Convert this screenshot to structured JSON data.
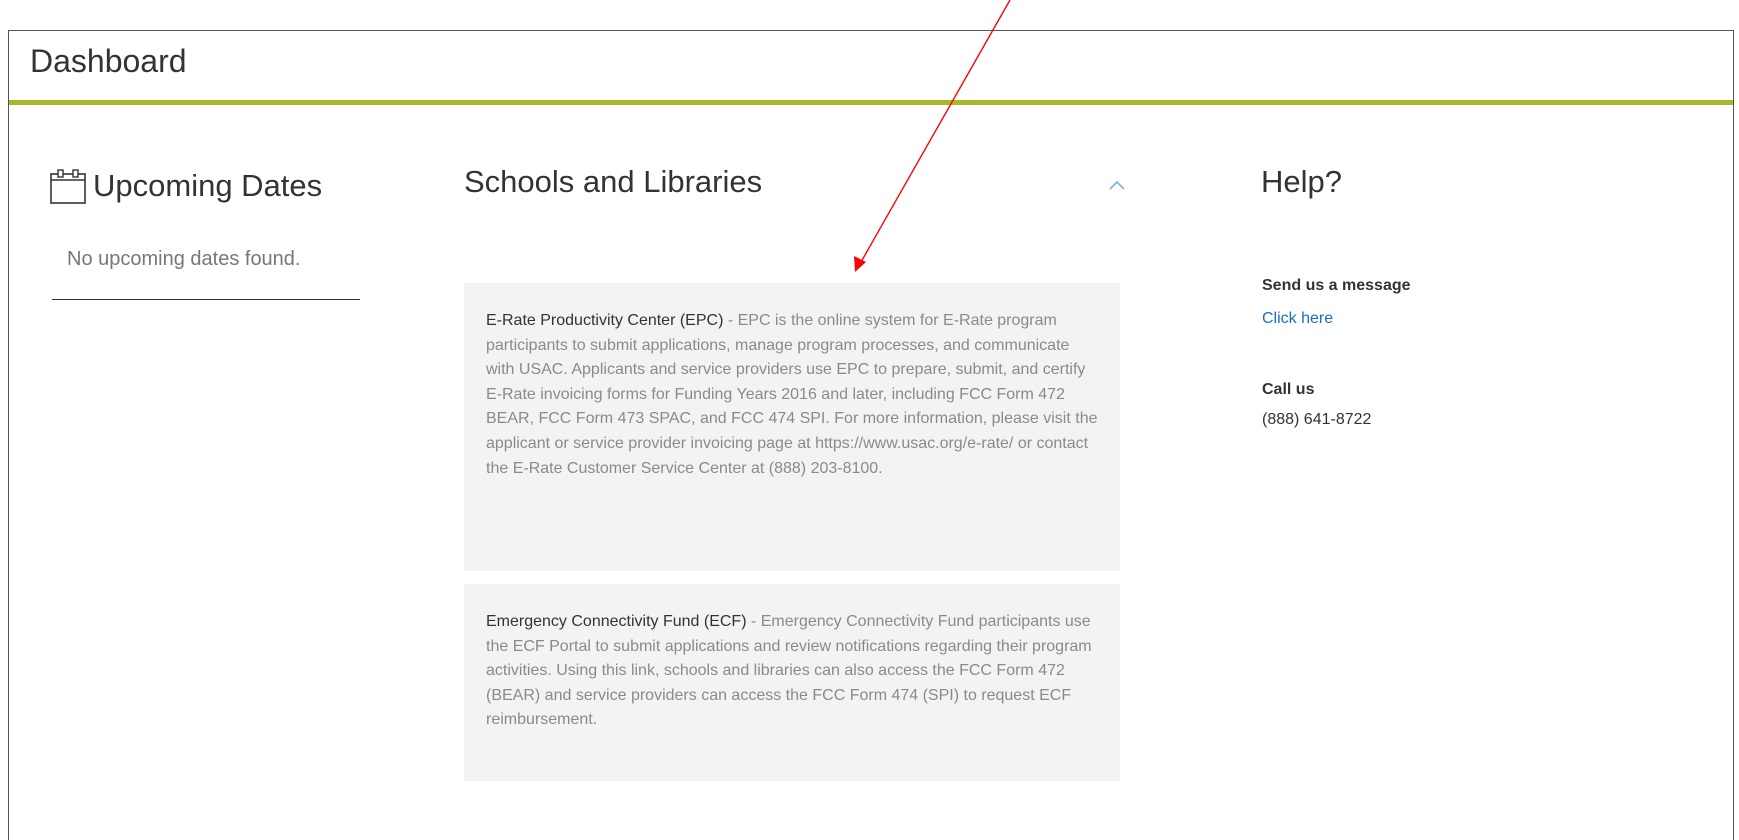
{
  "header": {
    "title": "Dashboard",
    "accent_color": "#a9b729"
  },
  "upcoming": {
    "title": "Upcoming Dates",
    "icon": "calendar-icon",
    "empty_text": "No upcoming dates found."
  },
  "schools": {
    "title": "Schools and Libraries",
    "collapse_icon": "chevron-up-icon",
    "cards": [
      {
        "title": "E-Rate Productivity Center (EPC)",
        "description": " - EPC is the online system for E-Rate program participants to submit applications, manage program processes, and communicate with USAC. Applicants and service providers use EPC to prepare, submit, and certify E-Rate invoicing forms for Funding Years 2016 and later, including FCC Form 472 BEAR, FCC Form 473 SPAC, and FCC 474 SPI. For more information, please visit the applicant or service provider invoicing page at https://www.usac.org/e-rate/ or contact the E-Rate Customer Service Center at (888) 203-8100."
      },
      {
        "title": "Emergency Connectivity Fund (ECF)",
        "description": " - Emergency Connectivity Fund participants use the ECF Portal to submit applications and review notifications regarding their program activities. Using this link, schools and libraries can also access the FCC Form 472 (BEAR) and service providers can access the FCC Form 474 (SPI) to request ECF reimbursement."
      }
    ]
  },
  "help": {
    "title": "Help?",
    "message_label": "Send us a message",
    "message_link": "Click here",
    "call_label": "Call us",
    "phone": "(888) 641-8722",
    "link_color": "#1a6fbf"
  },
  "annotation": {
    "arrow_color": "#ff0000"
  }
}
